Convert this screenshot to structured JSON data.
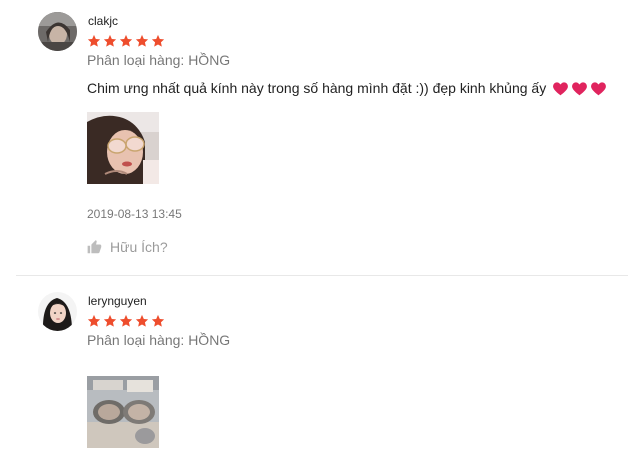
{
  "colors": {
    "star": "#ee4d2d",
    "heart": "#e0245e",
    "muted": "rgba(0,0,0,0.54)"
  },
  "reviews": [
    {
      "username": "clakjc",
      "rating": 5,
      "variation": "Phân loại hàng: HỒNG",
      "comment": "Chim ưng nhất quả kính này trong số hàng mình đặt :)) đẹp kinh khủng ấy",
      "emoji": [
        "heart",
        "heart",
        "heart"
      ],
      "timestamp": "2019-08-13 13:45",
      "helpful_label": "Hữu Ích?"
    },
    {
      "username": "lerynguyen",
      "rating": 5,
      "variation": "Phân loại hàng: HỒNG"
    }
  ]
}
